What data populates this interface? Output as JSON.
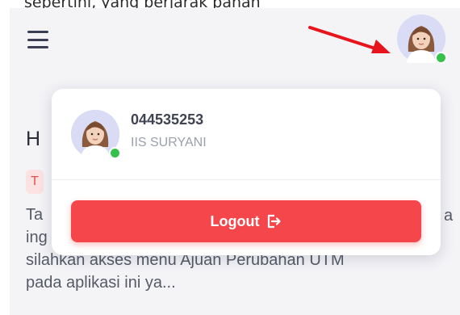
{
  "top_caption": "sepertini, yang berjarak panah",
  "background": {
    "heading_fragment": "H",
    "badge_fragment": "T",
    "text_lines": [
      "Ta",
      "ing",
      "silahkan akses menu Ajuan Perubahan UTM",
      "pada aplikasi ini ya..."
    ],
    "right_fragment": "a"
  },
  "user": {
    "id": "044535253",
    "name": "IIS SURYANI",
    "status": "online"
  },
  "menu": {
    "logout_label": "Logout"
  },
  "colors": {
    "logout_bg": "#f5474b",
    "online_dot": "#36c24a",
    "arrow": "#e8141c",
    "avatar_bg": "#d9dcf4"
  },
  "icons": {
    "menu": "hamburger-icon",
    "logout": "logout-icon",
    "annotation": "red-arrow"
  }
}
